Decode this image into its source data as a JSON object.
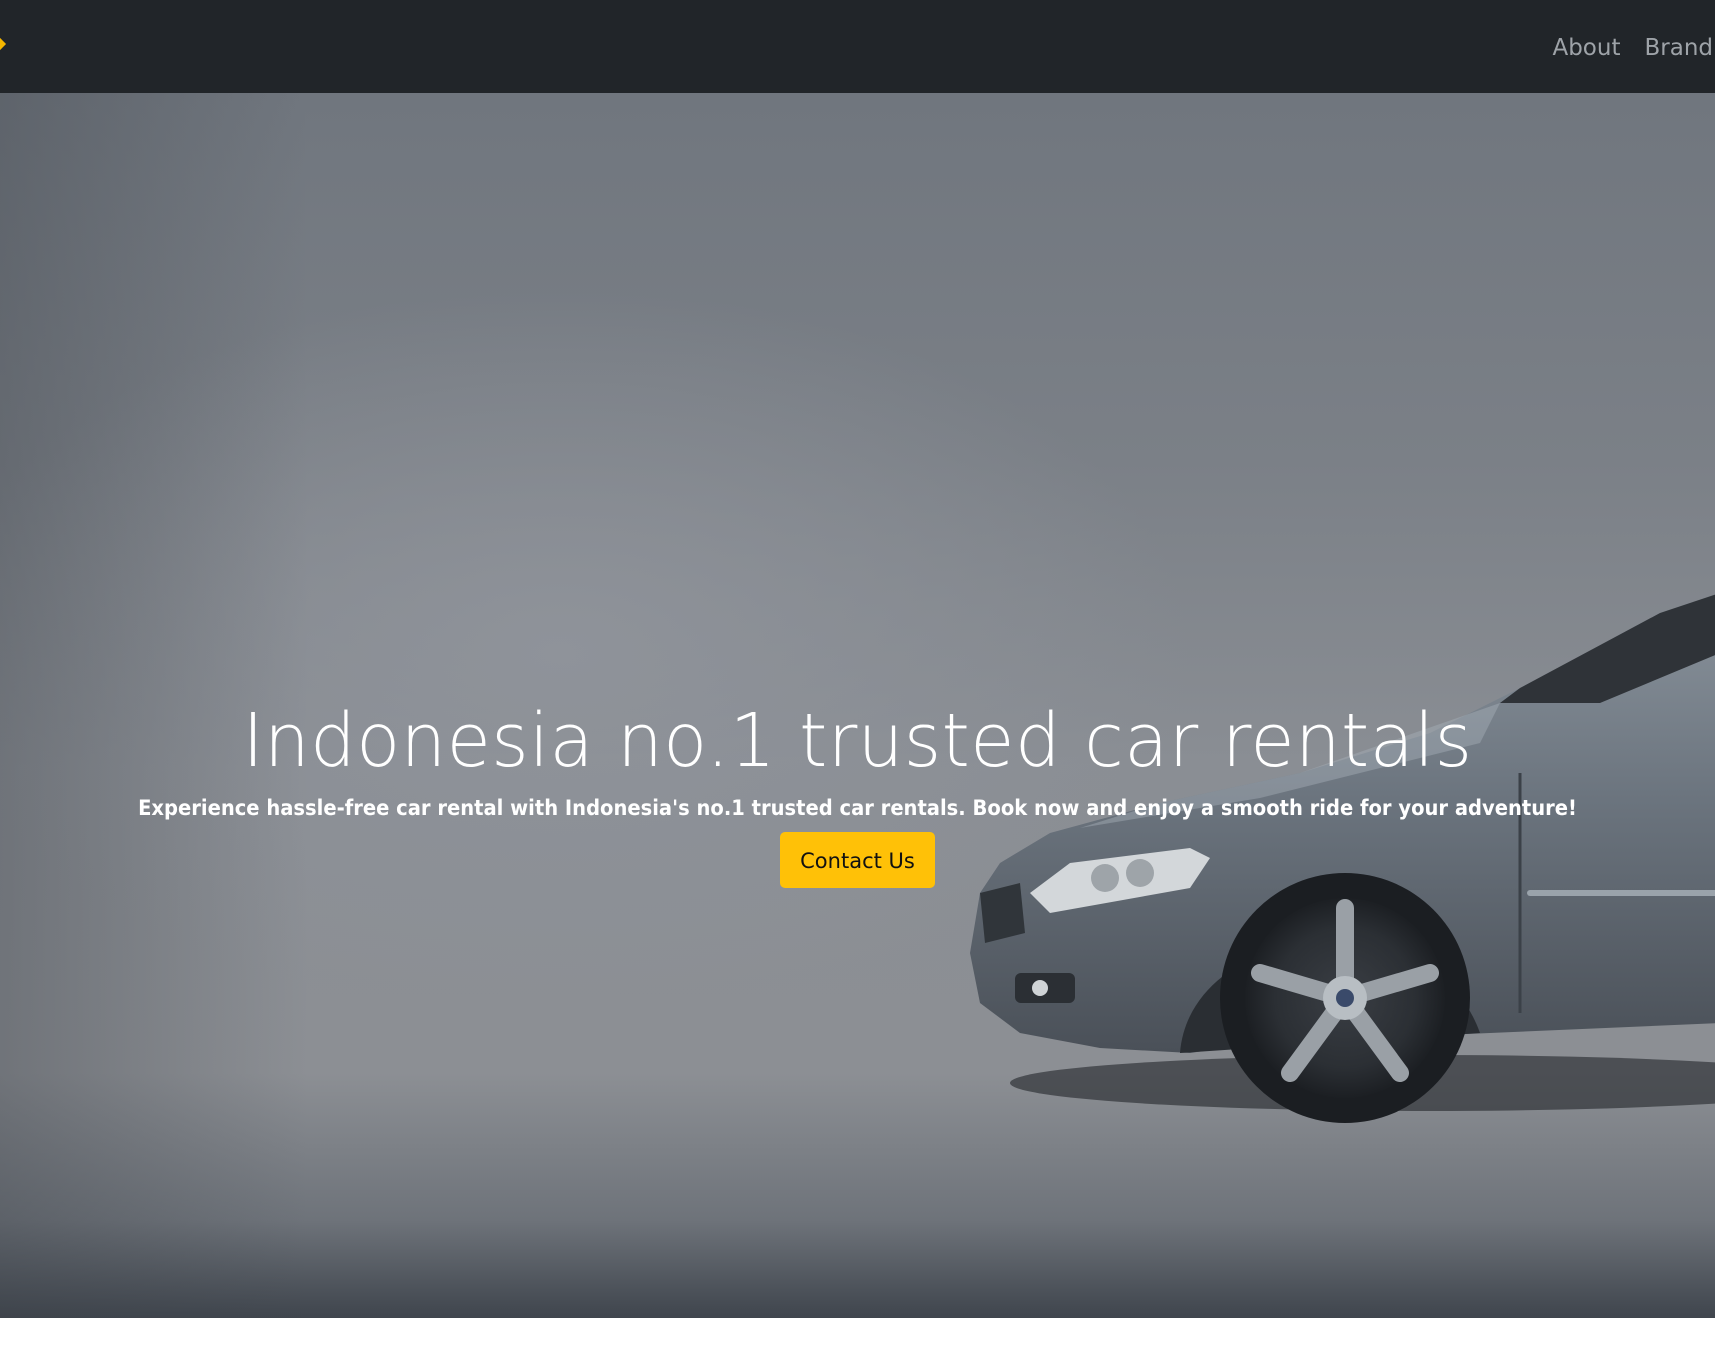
{
  "navbar": {
    "links": [
      {
        "label": "About"
      },
      {
        "label": "Brand"
      }
    ]
  },
  "hero": {
    "title": "Indonesia no.1 trusted car rentals",
    "subtitle": "Experience hassle-free car rental with Indonesia's no.1 trusted car rentals. Book now and enjoy a smooth ride for your adventure!",
    "cta_label": "Contact Us",
    "background_image": "silver-sedan-car-photo"
  },
  "colors": {
    "navbar_bg": "#212529",
    "nav_link": "#9ea3a8",
    "accent": "#ffc107",
    "hero_text": "#ffffff"
  }
}
